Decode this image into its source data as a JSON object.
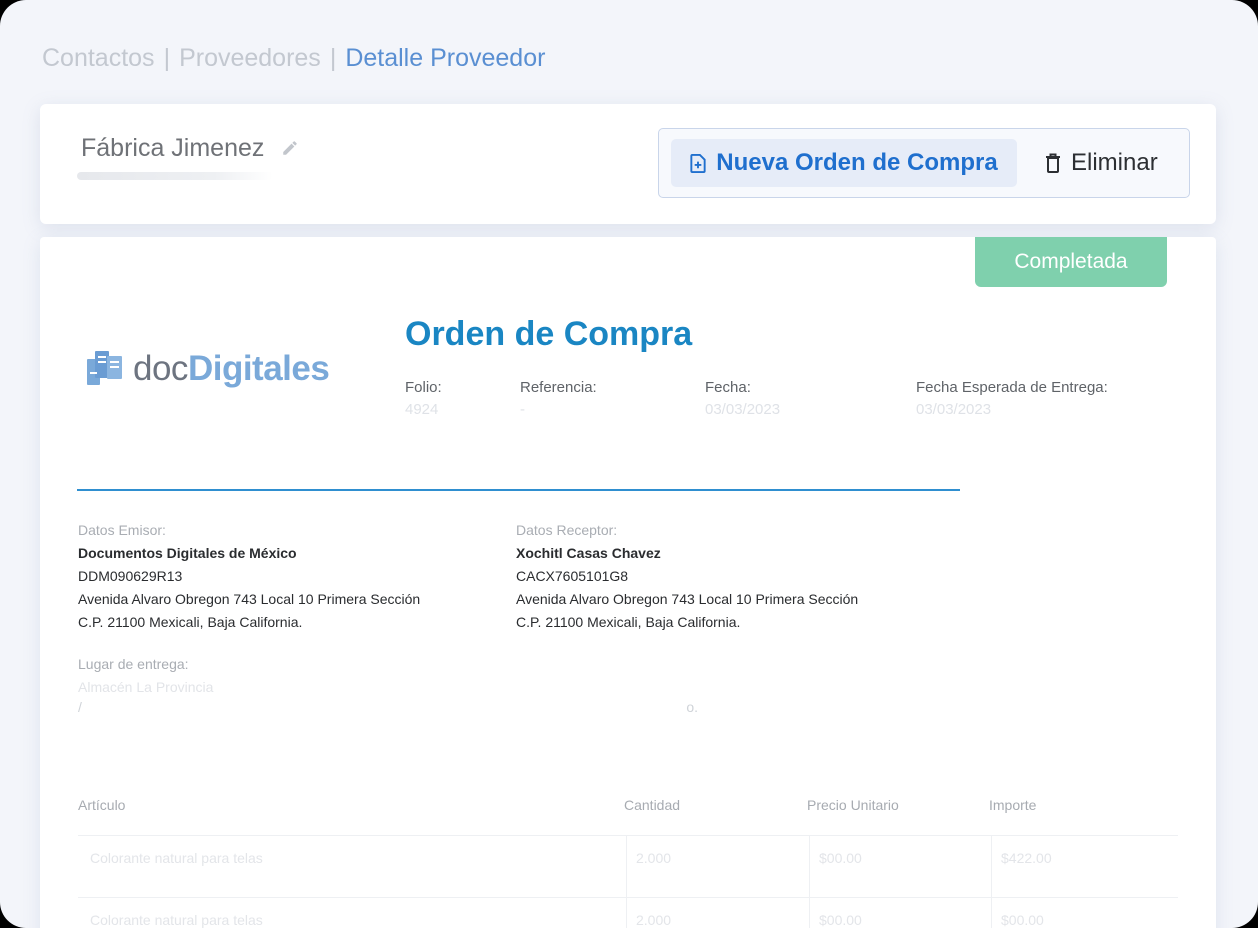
{
  "breadcrumb": {
    "items": [
      "Contactos",
      "Proveedores",
      "Detalle Proveedor"
    ],
    "separator": "|"
  },
  "header": {
    "supplier_name": "Fábrica Jimenez",
    "new_order_label": "Nueva Orden de Compra",
    "delete_label": "Eliminar"
  },
  "document": {
    "status": "Completada",
    "logo": {
      "prefix": "doc",
      "emphasis": "Digitales"
    },
    "title": "Orden de Compra",
    "meta": [
      {
        "label": "Folio:",
        "value": "4924"
      },
      {
        "label": "Referencia:",
        "value": "-"
      },
      {
        "label": "Fecha:",
        "value": "03/03/2023"
      },
      {
        "label": "Fecha Esperada de Entrega:",
        "value": "03/03/2023"
      }
    ],
    "emisor": {
      "label": "Datos Emisor:",
      "name": "Documentos Digitales de México",
      "rfc": "DDM090629R13",
      "address": "Avenida Alvaro Obregon 743 Local 10 Primera Sección",
      "city": "C.P. 21100 Mexicali, Baja California."
    },
    "receptor": {
      "label": "Datos Receptor:",
      "name": "Xochitl Casas Chavez",
      "rfc": "CACX7605101G8",
      "address": "Avenida Alvaro Obregon 743 Local 10 Primera Sección",
      "city": "C.P. 21100 Mexicali, Baja California."
    },
    "delivery": {
      "label": "Lugar de entrega:",
      "value": "Almacén La Provincia",
      "line2_start": "/",
      "line2_end": "o."
    },
    "items": {
      "headers": [
        "Artículo",
        "Cantidad",
        "Precio Unitario",
        "Importe"
      ],
      "rows": [
        {
          "article": "Colorante natural para telas",
          "qty": "2.000",
          "price": "$00.00",
          "amount": "$422.00"
        },
        {
          "article": "Colorante natural para telas",
          "qty": "2.000",
          "price": "$00.00",
          "amount": "$00.00"
        }
      ]
    }
  },
  "colors": {
    "accent": "#1f6fce",
    "title": "#1a86c3",
    "status": "#7fd0ad",
    "breadcrumb_active": "#5a8fd2"
  }
}
